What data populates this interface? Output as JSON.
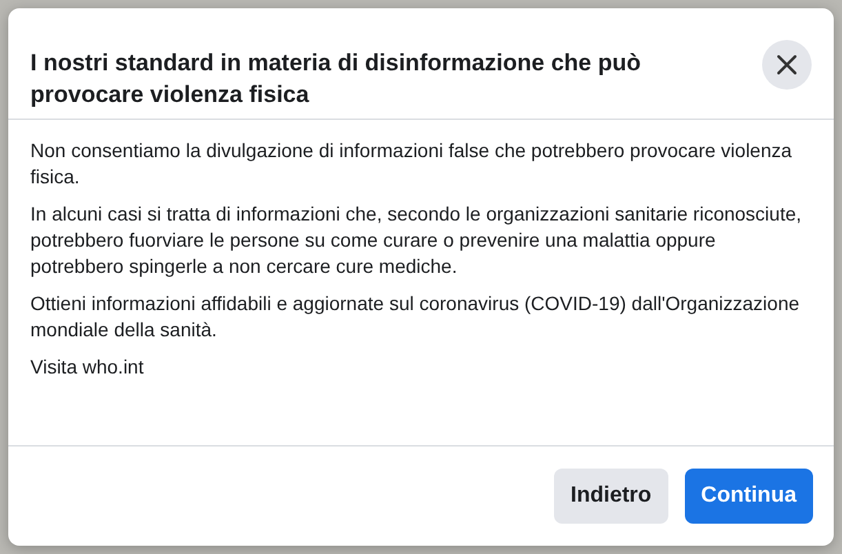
{
  "dialog": {
    "title": "I nostri standard in materia di disinformazione che può provocare violenza fisica",
    "paragraphs": [
      "Non consentiamo la divulgazione di informazioni false che potrebbero provocare violenza fisica.",
      "In alcuni casi si tratta di informazioni che, secondo le organizzazioni sanitarie riconosciute, potrebbero fuorviare le persone su come curare o prevenire una malattia oppure potrebbero spingerle a non cercare cure mediche.",
      "Ottieni informazioni affidabili e aggiornate sul coronavirus (COVID-19) dall'Organizzazione mondiale della sanità.",
      "Visita who.int"
    ],
    "buttons": [
      {
        "label": "Indietro",
        "kind": "secondary"
      },
      {
        "label": "Continua",
        "kind": "primary"
      }
    ]
  }
}
